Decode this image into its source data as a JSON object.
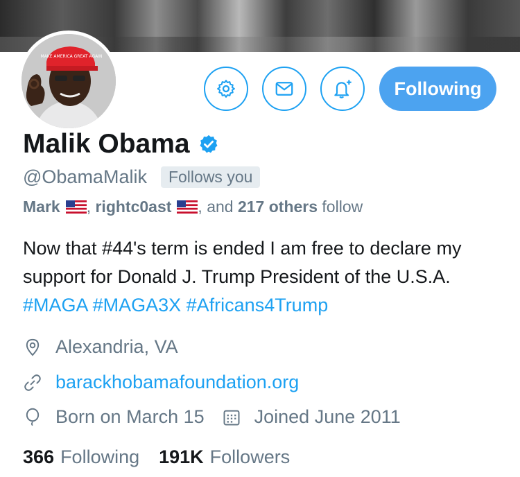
{
  "profile": {
    "name": "Malik Obama",
    "handle": "@ObamaMalik",
    "follows_you": "Follows you",
    "hat_text": "MAKE AMERICA GREAT AGAIN",
    "following_button": "Following"
  },
  "social_context": {
    "user1": "Mark",
    "user2": "rightc0ast",
    "middle": ", and ",
    "others": "217 others",
    "suffix": " follow",
    "sep": ", "
  },
  "bio": {
    "text": "Now that #44's term is ended I am free to declare my support for Donald J. Trump President of the U.S.A. ",
    "hashtags": [
      "#MAGA",
      "#MAGA3X",
      "#Africans4Trump"
    ]
  },
  "meta": {
    "location": "Alexandria, VA",
    "website": "barackhobamafoundation.org",
    "birthday": "Born on March 15",
    "joined": "Joined June 2011"
  },
  "stats": {
    "following_count": "366",
    "following_label": "Following",
    "followers_count": "191K",
    "followers_label": "Followers"
  },
  "icons": {
    "settings": "gear-icon",
    "message": "envelope-icon",
    "notifications": "bell-plus-icon",
    "verified": "verified-badge-icon",
    "location": "location-pin-icon",
    "link": "link-icon",
    "birthday": "balloon-icon",
    "joined": "calendar-icon"
  },
  "colors": {
    "accent": "#1da1f2",
    "button": "#4ca3f0",
    "muted": "#657786",
    "text": "#14171a"
  }
}
